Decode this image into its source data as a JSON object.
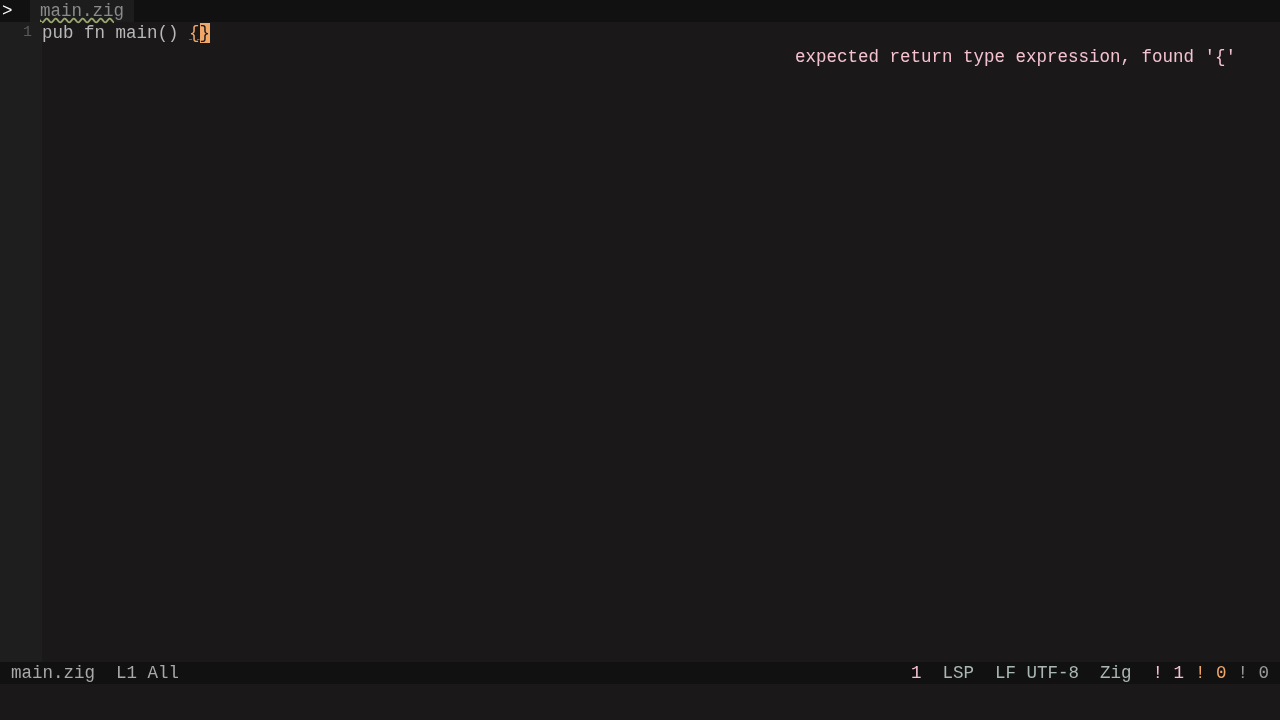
{
  "tabs": {
    "toggle": ">",
    "items": [
      {
        "label": "main.zig",
        "selected": true,
        "error": true
      }
    ]
  },
  "editor": {
    "lines": [
      {
        "number": "1",
        "text": "pub fn main() ",
        "error_text": "{",
        "cursor_char": "}"
      }
    ],
    "diagnostic": "expected return type expression, found '{'"
  },
  "status_bar": {
    "file": "main.zig",
    "position": "L1 All",
    "items": [
      {
        "text": "1",
        "color": "#f5c2d0"
      },
      {
        "text": "LSP",
        "color": "#a9b8b2"
      },
      {
        "text": "LF UTF-8",
        "color": "#a9b8b2"
      },
      {
        "text": "Zig",
        "color": "#a9b8b2"
      }
    ],
    "counts": [
      {
        "mark": "!",
        "value": "1",
        "color": "#f5c2d0"
      },
      {
        "mark": "!",
        "value": "0",
        "color": "#f0a868"
      },
      {
        "mark": "!",
        "value": "0",
        "color": "#9a9a9a"
      }
    ]
  }
}
